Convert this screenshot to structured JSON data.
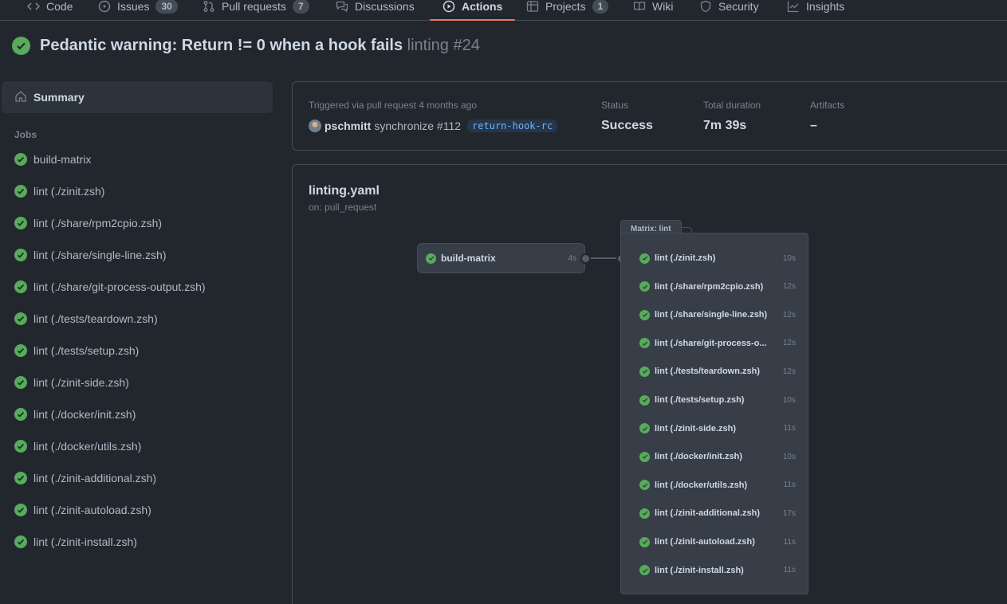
{
  "nav": {
    "tabs": [
      {
        "label": "Code",
        "icon": "code-icon"
      },
      {
        "label": "Issues",
        "icon": "issue-icon",
        "count": "30"
      },
      {
        "label": "Pull requests",
        "icon": "pull-request-icon",
        "count": "7"
      },
      {
        "label": "Discussions",
        "icon": "discussion-icon"
      },
      {
        "label": "Actions",
        "icon": "play-icon",
        "active": true
      },
      {
        "label": "Projects",
        "icon": "table-icon",
        "count": "1"
      },
      {
        "label": "Wiki",
        "icon": "book-icon"
      },
      {
        "label": "Security",
        "icon": "shield-icon"
      },
      {
        "label": "Insights",
        "icon": "graph-icon"
      }
    ],
    "accent_color": "#ec775c"
  },
  "run": {
    "title": "Pedantic warning: Return != 0 when a hook fails",
    "workflow_run": "linting #24",
    "status_color": "#57ab5a"
  },
  "sidebar": {
    "summary_label": "Summary",
    "jobs_heading": "Jobs",
    "jobs": [
      "build-matrix",
      "lint (./zinit.zsh)",
      "lint (./share/rpm2cpio.zsh)",
      "lint (./share/single-line.zsh)",
      "lint (./share/git-process-output.zsh)",
      "lint (./tests/teardown.zsh)",
      "lint (./tests/setup.zsh)",
      "lint (./zinit-side.zsh)",
      "lint (./docker/init.zsh)",
      "lint (./docker/utils.zsh)",
      "lint (./zinit-additional.zsh)",
      "lint (./zinit-autoload.zsh)",
      "lint (./zinit-install.zsh)"
    ]
  },
  "summary": {
    "triggered_text": "Triggered via pull request 4 months ago",
    "user": "pschmitt",
    "event_text": "synchronize #112",
    "branch": "return-hook-rc",
    "status_label": "Status",
    "status_value": "Success",
    "duration_label": "Total duration",
    "duration_value": "7m 39s",
    "artifacts_label": "Artifacts",
    "artifacts_value": "–"
  },
  "graph": {
    "workflow_file": "linting.yaml",
    "trigger": "on: pull_request",
    "build_node": {
      "label": "build-matrix",
      "duration": "4s"
    },
    "matrix_label": "Matrix: lint",
    "matrix_jobs": [
      {
        "label": "lint (./zinit.zsh)",
        "duration": "10s"
      },
      {
        "label": "lint (./share/rpm2cpio.zsh)",
        "duration": "12s"
      },
      {
        "label": "lint (./share/single-line.zsh)",
        "duration": "12s"
      },
      {
        "label": "lint (./share/git-process-o...",
        "duration": "12s"
      },
      {
        "label": "lint (./tests/teardown.zsh)",
        "duration": "12s"
      },
      {
        "label": "lint (./tests/setup.zsh)",
        "duration": "10s"
      },
      {
        "label": "lint (./zinit-side.zsh)",
        "duration": "11s"
      },
      {
        "label": "lint (./docker/init.zsh)",
        "duration": "10s"
      },
      {
        "label": "lint (./docker/utils.zsh)",
        "duration": "11s"
      },
      {
        "label": "lint (./zinit-additional.zsh)",
        "duration": "17s"
      },
      {
        "label": "lint (./zinit-autoload.zsh)",
        "duration": "11s"
      },
      {
        "label": "lint (./zinit-install.zsh)",
        "duration": "11s"
      }
    ]
  }
}
